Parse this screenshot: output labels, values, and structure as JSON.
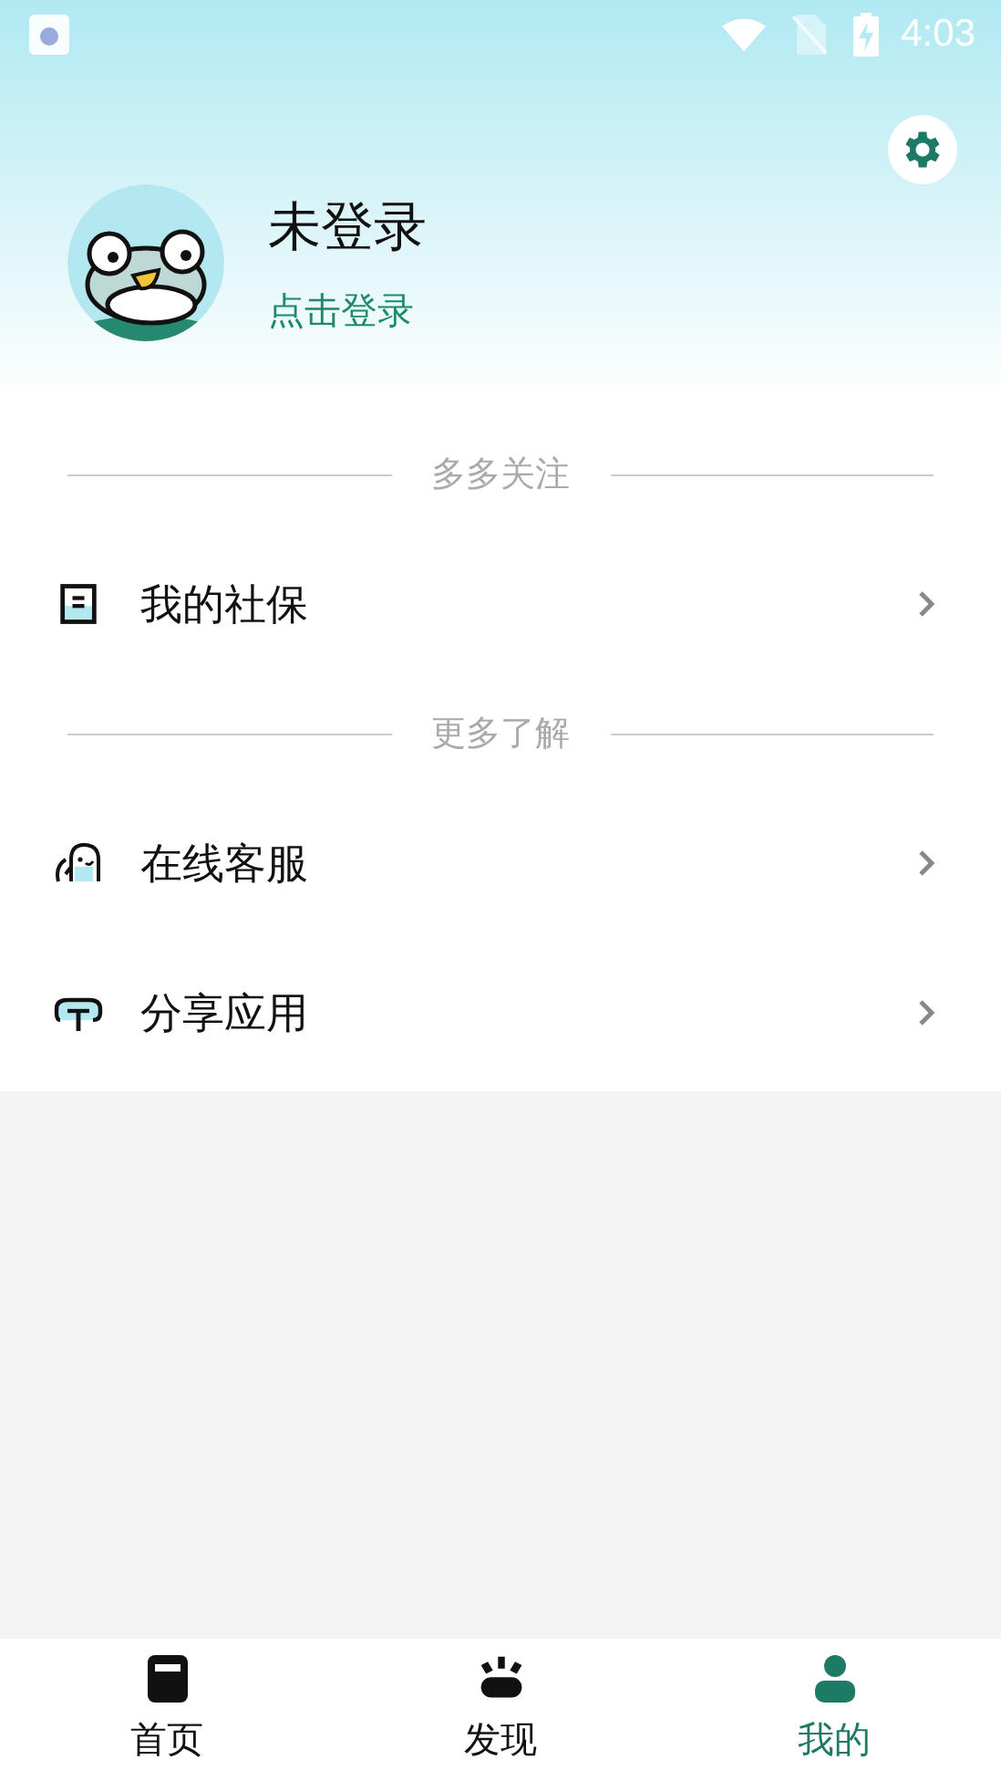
{
  "status_bar": {
    "time": "4:03"
  },
  "profile": {
    "name": "未登录",
    "login_link": "点击登录"
  },
  "sections": [
    {
      "title": "多多关注",
      "items": [
        {
          "label": "我的社保"
        }
      ]
    },
    {
      "title": "更多了解",
      "items": [
        {
          "label": "在线客服"
        },
        {
          "label": "分享应用"
        }
      ]
    }
  ],
  "tabs": [
    {
      "label": "首页",
      "selected": false
    },
    {
      "label": "发现",
      "selected": false
    },
    {
      "label": "我的",
      "selected": true
    }
  ]
}
